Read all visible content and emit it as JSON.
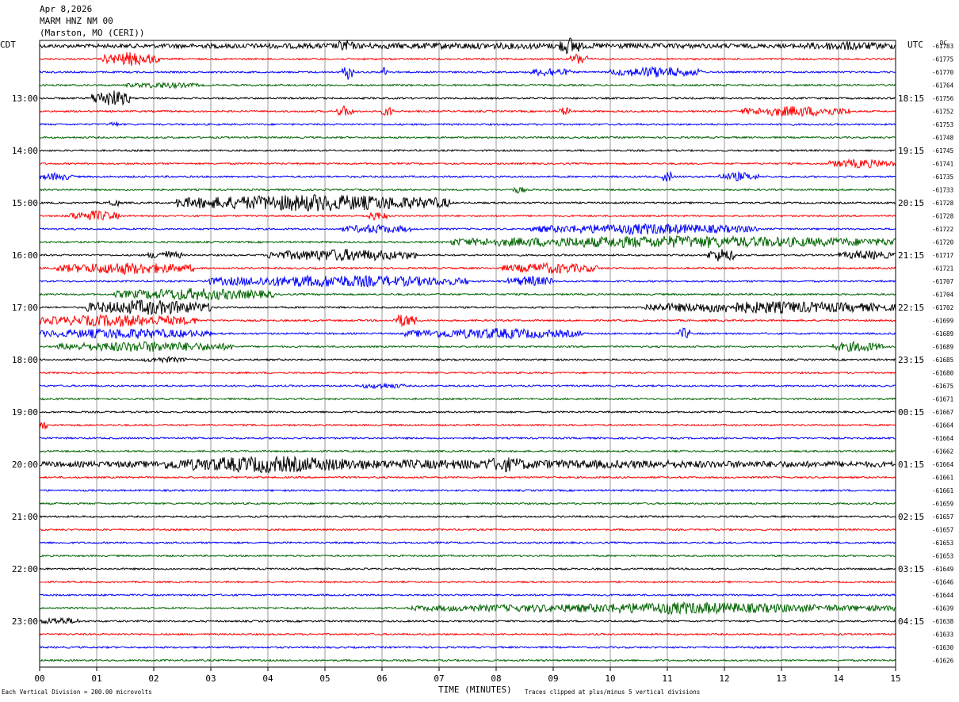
{
  "header": {
    "date": "Apr 8,2026",
    "station": "MARM HNZ NM 00",
    "location": "(Marston, MO (CERI))"
  },
  "labels": {
    "left_tz": "CDT",
    "right_tz": "UTC",
    "dc": "DC",
    "x_title": "TIME (MINUTES)",
    "scale_note": "Each Vertical Division =  200.00 microvolts",
    "clip_note": "Traces clipped at plus/minus 5 vertical divisions"
  },
  "chart_data": {
    "type": "line",
    "title": "MARM HNZ NM 00",
    "xlabel": "TIME (MINUTES)",
    "xlim": [
      0,
      15
    ],
    "x_ticks": [
      "00",
      "01",
      "02",
      "03",
      "04",
      "05",
      "06",
      "07",
      "08",
      "09",
      "10",
      "11",
      "12",
      "13",
      "14",
      "15"
    ],
    "rows_per_hour": 4,
    "row_colors": [
      "#000000",
      "#ff0000",
      "#0000ff",
      "#006400"
    ],
    "left_hour_labels": [
      "13:00",
      "14:00",
      "15:00",
      "16:00",
      "17:00",
      "18:00",
      "19:00",
      "20:00",
      "21:00",
      "22:00",
      "23:00"
    ],
    "right_hour_labels": [
      "18:15",
      "19:15",
      "20:15",
      "21:15",
      "22:15",
      "23:15",
      "00:15",
      "01:15",
      "02:15",
      "03:15",
      "04:15"
    ],
    "first_labeled_row": 4,
    "dc_offsets": [
      "-61783",
      "-61775",
      "-61770",
      "-61764",
      "-61756",
      "-61752",
      "-61753",
      "-61748",
      "-61745",
      "-61741",
      "-61735",
      "-61733",
      "-61728",
      "-61728",
      "-61722",
      "-61720",
      "-61717",
      "-61721",
      "-61707",
      "-61704",
      "-61702",
      "-61699",
      "-61689",
      "-61689",
      "-61685",
      "-61680",
      "-61675",
      "-61671",
      "-61667",
      "-61664",
      "-61664",
      "-61662",
      "-61664",
      "-61661",
      "-61661",
      "-61659",
      "-61657",
      "-61657",
      "-61653",
      "-61653",
      "-61649",
      "-61646",
      "-61644",
      "-61639",
      "-61638",
      "-61633",
      "-61630",
      "-61626"
    ],
    "activity_bursts": [
      {
        "row": 0,
        "x0": 0,
        "x1": 15,
        "amp": 4
      },
      {
        "row": 0,
        "x0": 5.2,
        "x1": 5.5,
        "amp": 9
      },
      {
        "row": 0,
        "x0": 9.1,
        "x1": 9.5,
        "amp": 12
      },
      {
        "row": 0,
        "x0": 13.2,
        "x1": 15,
        "amp": 6
      },
      {
        "row": 1,
        "x0": 1.1,
        "x1": 2.1,
        "amp": 9
      },
      {
        "row": 1,
        "x0": 9.3,
        "x1": 9.6,
        "amp": 8
      },
      {
        "row": 2,
        "x0": 5.3,
        "x1": 5.5,
        "amp": 10
      },
      {
        "row": 2,
        "x0": 6,
        "x1": 6.1,
        "amp": 8
      },
      {
        "row": 2,
        "x0": 8.6,
        "x1": 9.3,
        "amp": 6
      },
      {
        "row": 2,
        "x0": 10,
        "x1": 11.6,
        "amp": 7
      },
      {
        "row": 3,
        "x0": 1.5,
        "x1": 2.8,
        "amp": 4
      },
      {
        "row": 4,
        "x0": 0.9,
        "x1": 1.6,
        "amp": 11
      },
      {
        "row": 5,
        "x0": 5.2,
        "x1": 5.5,
        "amp": 7
      },
      {
        "row": 5,
        "x0": 6,
        "x1": 6.2,
        "amp": 7
      },
      {
        "row": 5,
        "x0": 9.1,
        "x1": 9.3,
        "amp": 6
      },
      {
        "row": 5,
        "x0": 12.3,
        "x1": 14.2,
        "amp": 7
      },
      {
        "row": 6,
        "x0": 1.2,
        "x1": 1.4,
        "amp": 4
      },
      {
        "row": 9,
        "x0": 13.8,
        "x1": 15,
        "amp": 6
      },
      {
        "row": 10,
        "x0": 0,
        "x1": 0.6,
        "amp": 5
      },
      {
        "row": 10,
        "x0": 10.9,
        "x1": 11.1,
        "amp": 8
      },
      {
        "row": 10,
        "x0": 11.9,
        "x1": 12.6,
        "amp": 6
      },
      {
        "row": 11,
        "x0": 8.3,
        "x1": 8.5,
        "amp": 5
      },
      {
        "row": 12,
        "x0": 2.4,
        "x1": 7.2,
        "amp": 11
      },
      {
        "row": 12,
        "x0": 1.2,
        "x1": 1.4,
        "amp": 6
      },
      {
        "row": 13,
        "x0": 0.5,
        "x1": 1.4,
        "amp": 7
      },
      {
        "row": 13,
        "x0": 5.7,
        "x1": 6.1,
        "amp": 6
      },
      {
        "row": 14,
        "x0": 5.3,
        "x1": 6.5,
        "amp": 6
      },
      {
        "row": 14,
        "x0": 8.6,
        "x1": 12.6,
        "amp": 7
      },
      {
        "row": 15,
        "x0": 7.2,
        "x1": 15,
        "amp": 8
      },
      {
        "row": 16,
        "x0": 1.9,
        "x1": 2.5,
        "amp": 6
      },
      {
        "row": 16,
        "x0": 4,
        "x1": 6.6,
        "amp": 8
      },
      {
        "row": 16,
        "x0": 11.7,
        "x1": 12.2,
        "amp": 9
      },
      {
        "row": 16,
        "x0": 14,
        "x1": 15,
        "amp": 6
      },
      {
        "row": 17,
        "x0": 0.3,
        "x1": 2.7,
        "amp": 8
      },
      {
        "row": 17,
        "x0": 8.1,
        "x1": 9.8,
        "amp": 7
      },
      {
        "row": 18,
        "x0": 2.9,
        "x1": 7.5,
        "amp": 8
      },
      {
        "row": 18,
        "x0": 8.2,
        "x1": 9,
        "amp": 7
      },
      {
        "row": 19,
        "x0": 1.3,
        "x1": 4.1,
        "amp": 8
      },
      {
        "row": 20,
        "x0": 0.8,
        "x1": 3,
        "amp": 10
      },
      {
        "row": 20,
        "x0": 10.6,
        "x1": 15,
        "amp": 8
      },
      {
        "row": 21,
        "x0": 0,
        "x1": 2.8,
        "amp": 8
      },
      {
        "row": 21,
        "x0": 6.2,
        "x1": 6.6,
        "amp": 9
      },
      {
        "row": 22,
        "x0": 0,
        "x1": 3,
        "amp": 7
      },
      {
        "row": 22,
        "x0": 6.4,
        "x1": 9.5,
        "amp": 7
      },
      {
        "row": 22,
        "x0": 11.2,
        "x1": 11.4,
        "amp": 8
      },
      {
        "row": 23,
        "x0": 0.3,
        "x1": 3.4,
        "amp": 7
      },
      {
        "row": 23,
        "x0": 13.9,
        "x1": 14.8,
        "amp": 7
      },
      {
        "row": 24,
        "x0": 1.8,
        "x1": 2.6,
        "amp": 4
      },
      {
        "row": 26,
        "x0": 5.6,
        "x1": 6.4,
        "amp": 4
      },
      {
        "row": 29,
        "x0": 0,
        "x1": 0.15,
        "amp": 6
      },
      {
        "row": 32,
        "x0": 0,
        "x1": 15,
        "amp": 6
      },
      {
        "row": 32,
        "x0": 2.2,
        "x1": 5.8,
        "amp": 11
      },
      {
        "row": 32,
        "x0": 7.7,
        "x1": 8.6,
        "amp": 10
      },
      {
        "row": 43,
        "x0": 6.5,
        "x1": 15,
        "amp": 6
      },
      {
        "row": 43,
        "x0": 9,
        "x1": 13.6,
        "amp": 8
      },
      {
        "row": 44,
        "x0": 0,
        "x1": 0.7,
        "amp": 5
      }
    ]
  }
}
